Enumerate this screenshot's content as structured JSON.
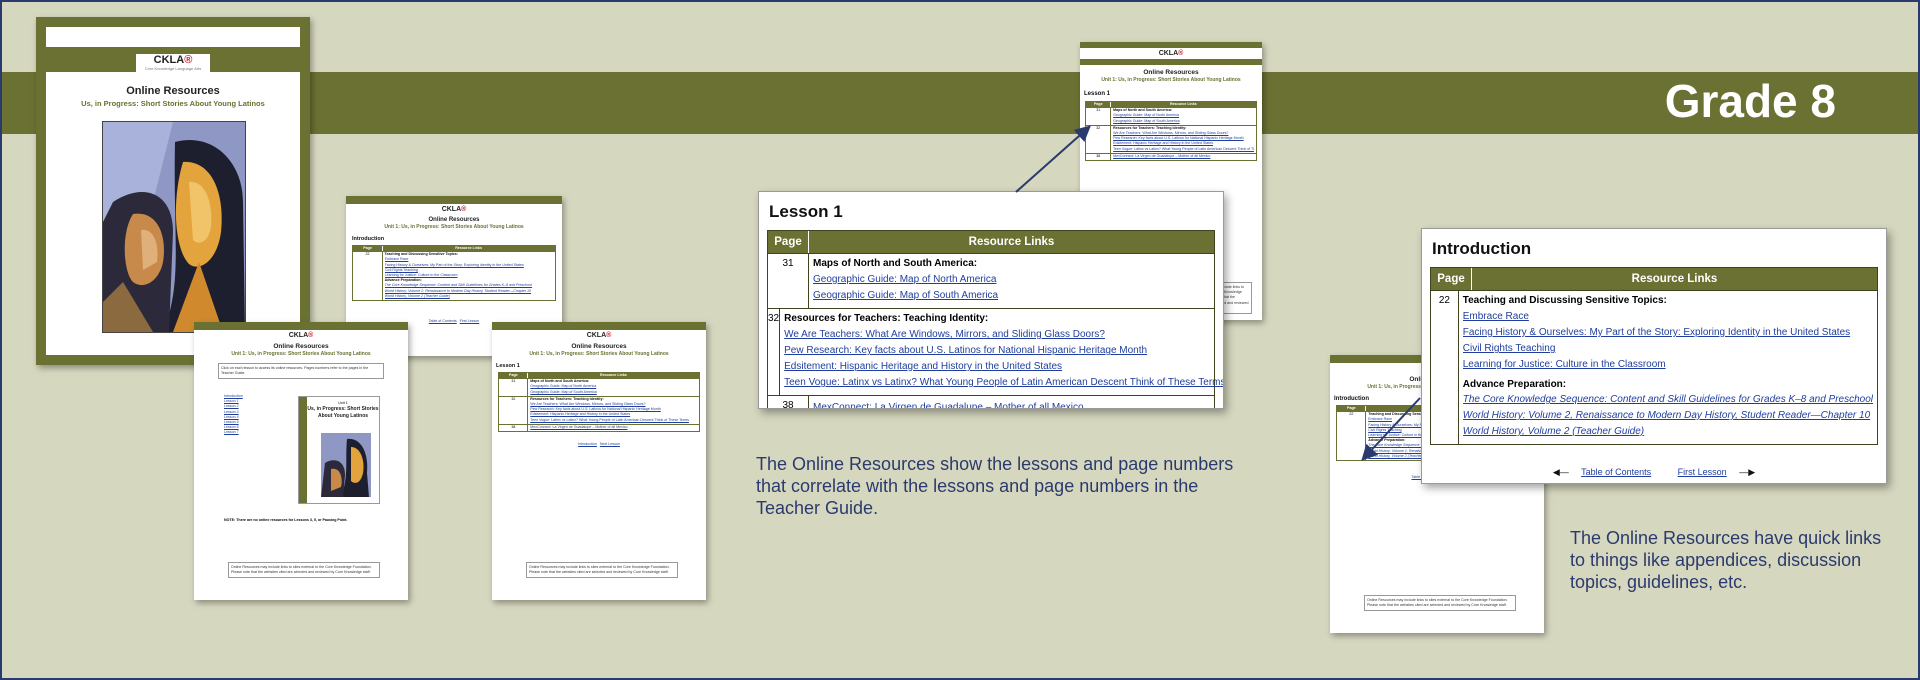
{
  "banner": {
    "grade": "Grade 8"
  },
  "logo": {
    "text": "CKLA",
    "sup": "®",
    "sub": "Core Knowledge Language Arts"
  },
  "resource": {
    "title": "Online Resources",
    "subtitle_cover": "Us, in Progress: Short Stories About Young Latinos",
    "subtitle_unit": "Unit 1: Us, in Progress: Short Stories About Young Latinos",
    "unit_label": "Unit 1",
    "unit_title": "Us, in Progress: Short Stories About Young Latinos",
    "toc_intro": "Click on each lesson to access its online resources. Pages numbers refer to the pages in the Teacher Guide.",
    "toc_items": [
      "Introduction",
      "Lesson 1",
      "Lesson 2",
      "Lesson 3",
      "Lesson 4",
      "Lesson 5",
      "Lesson 6",
      "Lesson 7"
    ],
    "toc_note": "NOTE: There are no online resources for Lessons 3, 5, or Pausing Point.",
    "disclaimer": "Online Resources may include links to sites external to the Core Knowledge Foundation. Please note that the websites cited are selected and reviewed by Core Knowledge staff."
  },
  "table_header": {
    "page": "Page",
    "links": "Resource Links"
  },
  "lesson1": {
    "heading": "Lesson 1",
    "rows": [
      {
        "page": "31",
        "heading": "Maps of North and South America:",
        "links": [
          "Geographic Guide: Map of North America",
          "Geographic Guide: Map of South America"
        ]
      },
      {
        "page": "32",
        "heading": "Resources for Teachers: Teaching Identity:",
        "links": [
          "We Are Teachers: What Are Windows, Mirrors, and Sliding Glass Doors?",
          "Pew Research: Key facts about U.S. Latinos for National Hispanic Heritage Month",
          "Edsitement: Hispanic Heritage and History in the United States",
          "Teen Vogue: Latinx vs Latinx? What Young People of Latin American Descent Think of These Terms"
        ]
      },
      {
        "page": "38",
        "links": [
          "MexConnect: La Virgen de Guadalupe – Mother of all Mexico"
        ]
      }
    ]
  },
  "intro": {
    "heading": "Introduction",
    "page": "22",
    "heading1": "Teaching and Discussing Sensitive Topics:",
    "links1": [
      "Embrace Race",
      "Facing History & Ourselves: My Part of the Story: Exploring Identity in the United States",
      "Civil Rights Teaching",
      "Learning for Justice: Culture in the Classroom"
    ],
    "heading2": "Advance Preparation:",
    "links2": [
      "The Core Knowledge Sequence: Content and Skill Guidelines for Grades K–8 and Preschool",
      "World History: Volume 2, Renaissance to Modern Day History, Student Reader—Chapter 10",
      "World History, Volume 2 (Teacher Guide)"
    ]
  },
  "nav": {
    "toc": "Table of Contents",
    "first": "First Lesson",
    "intro": "Introduction",
    "next": "Next Lesson"
  },
  "captions": {
    "left": "The Online Resources show the lessons and page numbers that correlate with the lessons and page numbers in the Teacher Guide.",
    "right": "The Online Resources have quick links to things like appendices, discussion topics, guidelines, etc."
  },
  "colors": {
    "olive": "#6b7132",
    "navy": "#2b3a6e",
    "background": "#d6d7bf",
    "link": "#1f3e9e"
  }
}
